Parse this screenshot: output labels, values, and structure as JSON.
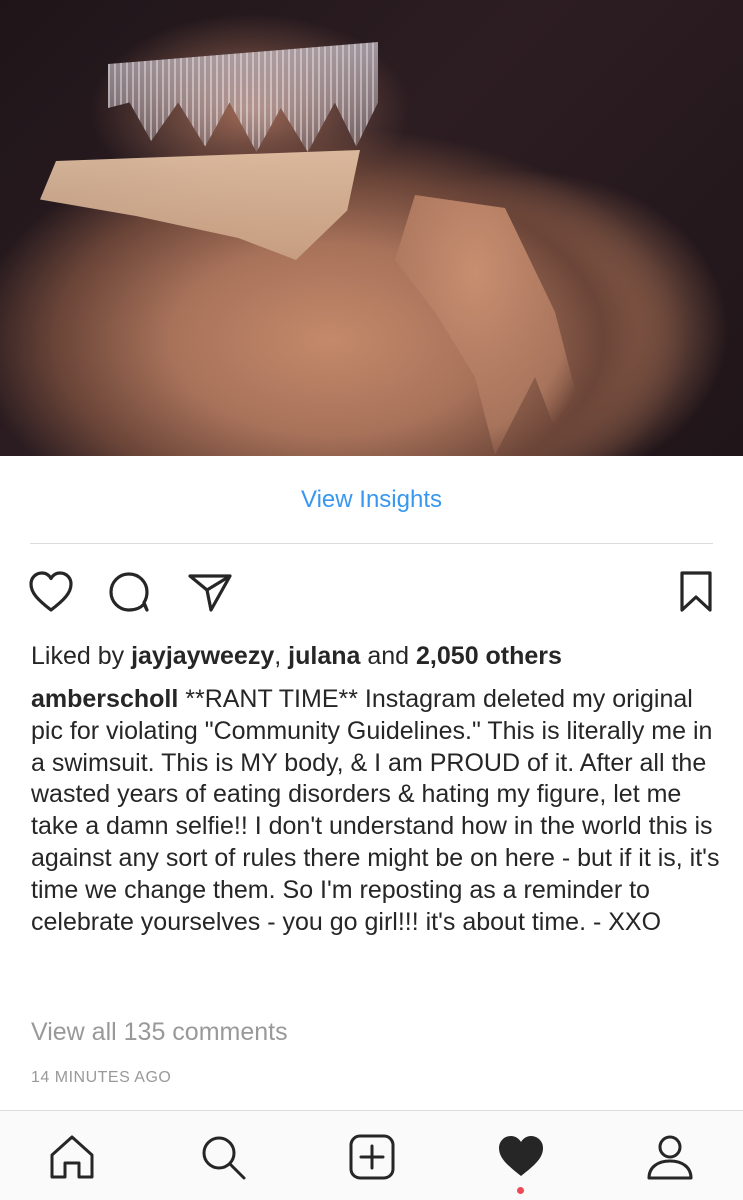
{
  "post": {
    "photo_icon": "photo",
    "insights_label": "View Insights",
    "likes": {
      "prefix": "Liked by",
      "user1": "jayjayweezy",
      "sep": ",",
      "user2": "julana",
      "and": "and",
      "others": "2,050 others"
    },
    "caption": {
      "username": "amberscholl",
      "text": "**RANT TIME** Instagram deleted my original pic for violating \"Community Guidelines.\" This is literally me in a swimsuit. This is MY body, & I am PROUD of it. After all the wasted years of eating disorders & hating my figure, let me take a damn selfie!! I don't understand how in the world this is against any sort of rules there might be on here - but if it is, it's time we change them. So I'm reposting as a reminder to celebrate yourselves - you go girl!!! it's about time. - XXO"
    },
    "view_comments": "View all 135 comments",
    "timestamp": "14 MINUTES AGO"
  },
  "actions": {
    "icons": [
      "heart-outline-icon",
      "comment-icon",
      "share-icon",
      "bookmark-icon"
    ]
  },
  "tabbar": {
    "icons": [
      "home-icon",
      "search-icon",
      "new-post-icon",
      "activity-heart-icon",
      "profile-icon"
    ],
    "active_dot_color": "#ed4956"
  },
  "colors": {
    "link": "#3897f0",
    "text": "#262626",
    "muted": "#999999"
  }
}
